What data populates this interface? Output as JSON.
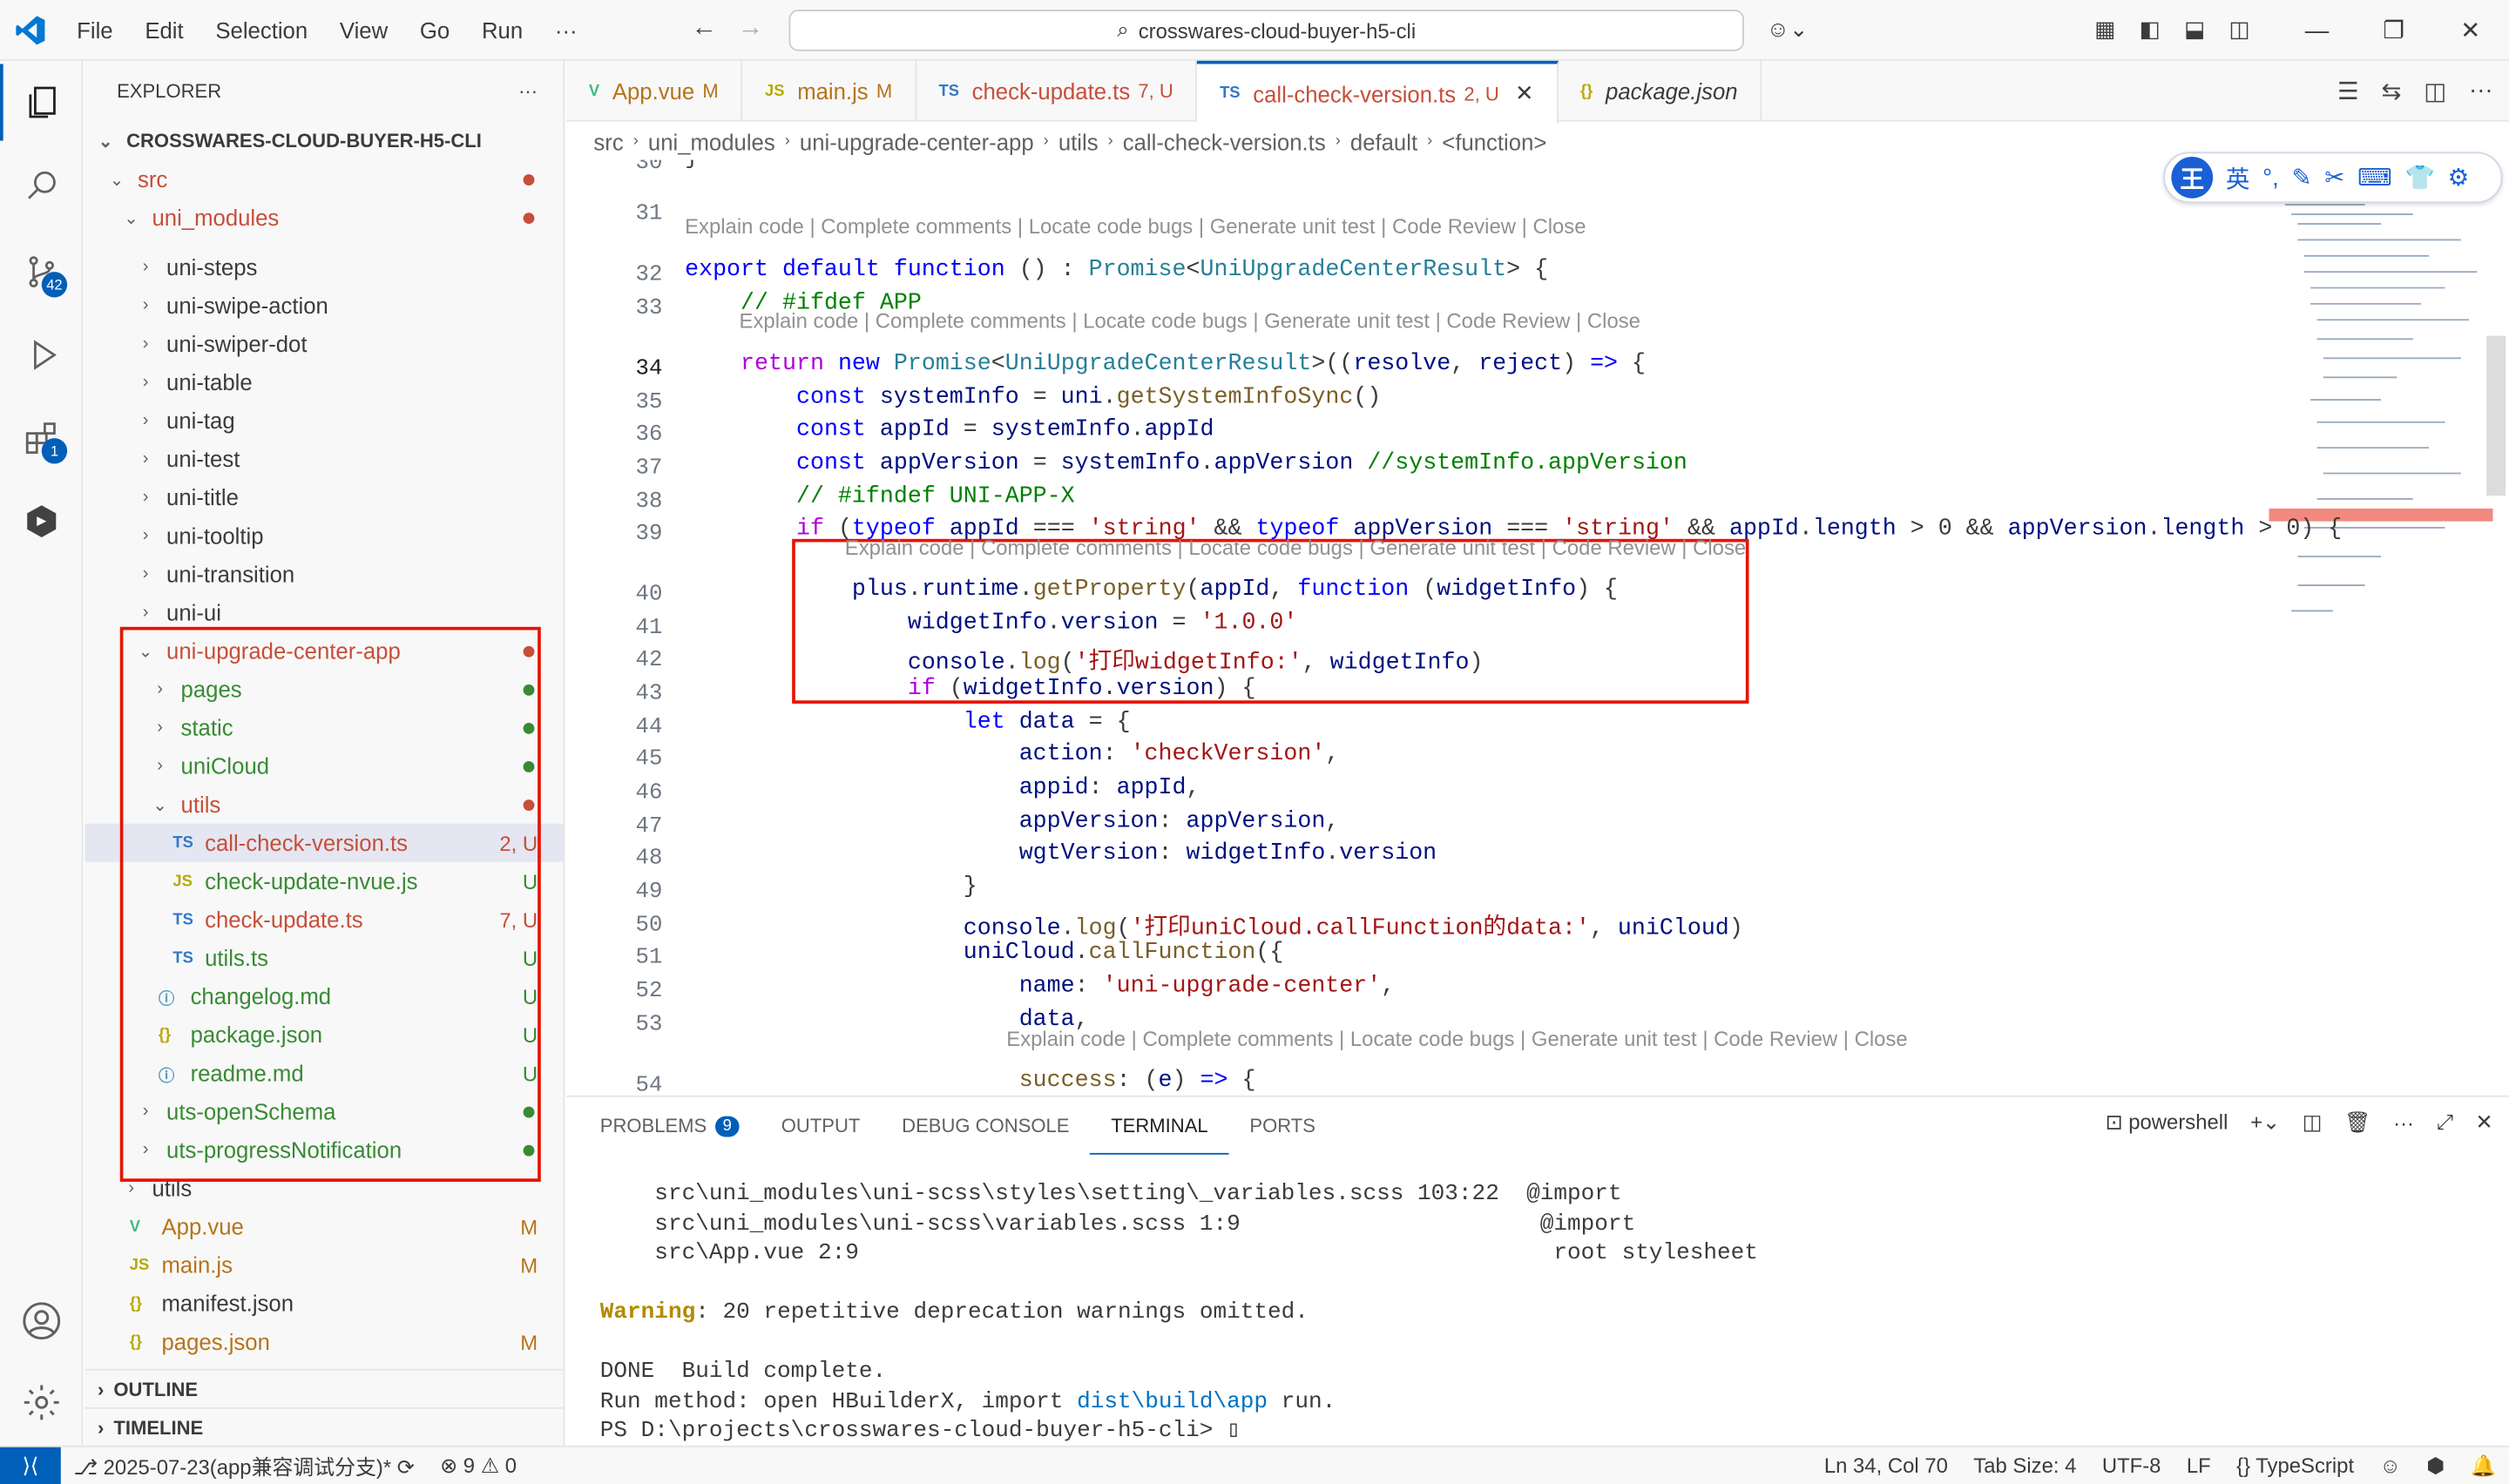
{
  "menu": [
    "File",
    "Edit",
    "Selection",
    "View",
    "Go",
    "Run",
    "···"
  ],
  "search": "crosswares-cloud-buyer-h5-cli",
  "explorer": {
    "title": "EXPLORER",
    "project": "CROSSWARES-CLOUD-BUYER-H5-CLI"
  },
  "tree": [
    {
      "label": "src",
      "indent": 1,
      "chev": "⌄",
      "cls": "red",
      "dot": "#c74e39"
    },
    {
      "label": "uni_modules",
      "indent": 2,
      "chev": "⌄",
      "cls": "red",
      "dot": "#c74e39"
    },
    {
      "label": "uni-steps",
      "indent": 3,
      "chev": "›",
      "cls": ""
    },
    {
      "label": "uni-swipe-action",
      "indent": 3,
      "chev": "›",
      "cls": ""
    },
    {
      "label": "uni-swiper-dot",
      "indent": 3,
      "chev": "›",
      "cls": ""
    },
    {
      "label": "uni-table",
      "indent": 3,
      "chev": "›",
      "cls": ""
    },
    {
      "label": "uni-tag",
      "indent": 3,
      "chev": "›",
      "cls": ""
    },
    {
      "label": "uni-test",
      "indent": 3,
      "chev": "›",
      "cls": ""
    },
    {
      "label": "uni-title",
      "indent": 3,
      "chev": "›",
      "cls": ""
    },
    {
      "label": "uni-tooltip",
      "indent": 3,
      "chev": "›",
      "cls": ""
    },
    {
      "label": "uni-transition",
      "indent": 3,
      "chev": "›",
      "cls": ""
    },
    {
      "label": "uni-ui",
      "indent": 3,
      "chev": "›",
      "cls": ""
    },
    {
      "label": "uni-upgrade-center-app",
      "indent": 3,
      "chev": "⌄",
      "cls": "red",
      "dot": "#c74e39"
    },
    {
      "label": "pages",
      "indent": 4,
      "chev": "›",
      "cls": "green",
      "dot": "#388a34"
    },
    {
      "label": "static",
      "indent": 4,
      "chev": "›",
      "cls": "green",
      "dot": "#388a34"
    },
    {
      "label": "uniCloud",
      "indent": 4,
      "chev": "›",
      "cls": "green",
      "dot": "#388a34"
    },
    {
      "label": "utils",
      "indent": 4,
      "chev": "⌄",
      "cls": "red",
      "dot": "#c74e39"
    },
    {
      "label": "call-check-version.ts",
      "indent": 5,
      "icon": "TS",
      "iconColor": "#3178c6",
      "cls": "red",
      "status": "2, U",
      "sel": true
    },
    {
      "label": "check-update-nvue.js",
      "indent": 5,
      "icon": "JS",
      "iconColor": "#b8a800",
      "cls": "green",
      "status": "U"
    },
    {
      "label": "check-update.ts",
      "indent": 5,
      "icon": "TS",
      "iconColor": "#3178c6",
      "cls": "red",
      "status": "7, U"
    },
    {
      "label": "utils.ts",
      "indent": 5,
      "icon": "TS",
      "iconColor": "#3178c6",
      "cls": "green",
      "status": "U"
    },
    {
      "label": "changelog.md",
      "indent": 4,
      "icon": "ⓘ",
      "iconColor": "#519aba",
      "cls": "green",
      "status": "U"
    },
    {
      "label": "package.json",
      "indent": 4,
      "icon": "{}",
      "iconColor": "#b8a800",
      "cls": "green",
      "status": "U"
    },
    {
      "label": "readme.md",
      "indent": 4,
      "icon": "ⓘ",
      "iconColor": "#519aba",
      "cls": "green",
      "status": "U"
    },
    {
      "label": "uts-openSchema",
      "indent": 3,
      "chev": "›",
      "cls": "green",
      "dot": "#388a34"
    },
    {
      "label": "uts-progressNotification",
      "indent": 3,
      "chev": "›",
      "cls": "green",
      "dot": "#388a34"
    },
    {
      "label": "utils",
      "indent": 2,
      "chev": "›",
      "cls": ""
    },
    {
      "label": "App.vue",
      "indent": 2,
      "icon": "V",
      "iconColor": "#41b883",
      "cls": "mod",
      "status": "M"
    },
    {
      "label": "main.js",
      "indent": 2,
      "icon": "JS",
      "iconColor": "#b8a800",
      "cls": "mod",
      "status": "M"
    },
    {
      "label": "manifest.json",
      "indent": 2,
      "icon": "{}",
      "iconColor": "#b8a800",
      "cls": ""
    },
    {
      "label": "pages.json",
      "indent": 2,
      "icon": "{}",
      "iconColor": "#b8a800",
      "cls": "mod",
      "status": "M"
    }
  ],
  "outline": "OUTLINE",
  "timeline": "TIMELINE",
  "tabs": [
    {
      "icon": "V",
      "iconColor": "#41b883",
      "label": "App.vue",
      "status": "M",
      "cls": "mod"
    },
    {
      "icon": "JS",
      "iconColor": "#b8a800",
      "label": "main.js",
      "status": "M",
      "cls": "mod"
    },
    {
      "icon": "TS",
      "iconColor": "#3178c6",
      "label": "check-update.ts",
      "status": "7, U",
      "cls": "red"
    },
    {
      "icon": "TS",
      "iconColor": "#3178c6",
      "label": "call-check-version.ts",
      "status": "2, U",
      "cls": "red",
      "active": true
    },
    {
      "icon": "{}",
      "iconColor": "#b8a800",
      "label": "package.json",
      "status": "",
      "cls": "",
      "italic": true
    }
  ],
  "breadcrumb": [
    "src",
    "uni_modules",
    "uni-upgrade-center-app",
    "utils",
    "call-check-version.ts",
    "default",
    "<function>"
  ],
  "lens": "Explain code | Complete comments | Locate code bugs | Generate unit test | Code Review | Close",
  "code": {
    "l30": "}",
    "l31": "",
    "l32": "<span class='kw'>export default function</span> () : <span class='ty'>Promise</span>&lt;<span class='ty'>UniUpgradeCenterResult</span>&gt; {",
    "l33": "    <span class='cm'>// #ifdef APP</span>",
    "l34": "    <span class='ctl'>return</span> <span class='kw'>new</span> <span class='ty'>Promise</span>&lt;<span class='ty'>UniUpgradeCenterResult</span>&gt;((<span class='va'>resolve</span>, <span class='va'>reject</span>) <span class='kw'>=&gt;</span> {",
    "l35": "        <span class='kw'>const</span> <span class='va'>systemInfo</span> = <span class='va'>uni</span>.<span class='fn'>getSystemInfoSync</span>()",
    "l36": "        <span class='kw'>const</span> <span class='va'>appId</span> = <span class='va'>systemInfo</span>.<span class='va'>appId</span>",
    "l37": "        <span class='kw'>const</span> <span class='va'>appVersion</span> = <span class='va'>systemInfo</span>.<span class='va'>appVersion</span> <span class='cm'>//systemInfo.appVersion</span>",
    "l38": "        <span class='cm'>// #ifndef UNI-APP-X</span>",
    "l39": "        <span class='ctl'>if</span> (<span class='kw'>typeof</span> <span class='va'>appId</span> === <span class='str'>'string'</span> &amp;&amp; <span class='kw'>typeof</span> <span class='va'>appVersion</span> === <span class='str'>'string'</span> &amp;&amp; <span class='va'>appId</span>.<span class='va'>length</span> &gt; 0 &amp;&amp; <span class='va'>appVersion</span>.<span class='va'>length</span> &gt; 0) {",
    "l40": "            <span class='va'>plus</span>.<span class='va'>runtime</span>.<span class='fn'>getProperty</span>(<span class='va'>appId</span>, <span class='kw'>function</span> (<span class='va'>widgetInfo</span>) {",
    "l41": "                <span class='va'>widgetInfo</span>.<span class='va'>version</span> = <span class='str'>'1.0.0'</span>",
    "l42": "                <span class='va'>console</span>.<span class='fn'>log</span>(<span class='str'>'打印widgetInfo:'</span>, <span class='va'>widgetInfo</span>)",
    "l43": "                <span class='ctl'>if</span> (<span class='va'>widgetInfo</span>.<span class='va'>version</span>) {",
    "l44": "                    <span class='kw'>let</span> <span class='va'>data</span> = {",
    "l45": "                        <span class='va'>action</span>: <span class='str'>'checkVersion'</span>,",
    "l46": "                        <span class='va'>appid</span>: <span class='va'>appId</span>,",
    "l47": "                        <span class='va'>appVersion</span>: <span class='va'>appVersion</span>,",
    "l48": "                        <span class='va'>wgtVersion</span>: <span class='va'>widgetInfo</span>.<span class='va'>version</span>",
    "l49": "                    }",
    "l50": "                    <span class='va'>console</span>.<span class='fn'>log</span>(<span class='str'>'打印uniCloud.callFunction的data:'</span>, <span class='va'>uniCloud</span>)",
    "l51": "                    <span class='va'>uniCloud</span>.<span class='fn'>callFunction</span>({",
    "l52": "                        <span class='va'>name</span>: <span class='str'>'uni-upgrade-center'</span>,",
    "l53": "                        <span class='va'>data</span>,",
    "l54": "                        <span class='fn'>success</span>: (<span class='va'>e</span>) <span class='kw'>=&gt;</span> {"
  },
  "panel": {
    "tabs": [
      "PROBLEMS",
      "OUTPUT",
      "DEBUG CONSOLE",
      "TERMINAL",
      "PORTS"
    ],
    "problems_count": "9",
    "shell": "powershell"
  },
  "terminal": [
    "    src\\uni_modules\\uni-scss\\styles\\setting\\_variables.scss 103:22  @import",
    "    src\\uni_modules\\uni-scss\\variables.scss 1:9                      @import",
    "    src\\App.vue 2:9                                                   root stylesheet",
    "",
    "<b style='color:#b58900'>Warning</b>: 20 repetitive deprecation warnings omitted.",
    "",
    "DONE  Build complete.",
    "Run method: open HBuilderX, import <span style='color:#0070c1'>dist\\build\\app</span> run.",
    "PS D:\\projects\\crosswares-cloud-buyer-h5-cli> ▯"
  ],
  "status": {
    "branch": "2025-07-23(app兼容调试分支)*",
    "errors": "9",
    "warnings": "0",
    "position": "Ln 34, Col 70",
    "tabsize": "Tab Size: 4",
    "encoding": "UTF-8",
    "eol": "LF",
    "language": "TypeScript"
  },
  "ime": {
    "w": "王",
    "lang": "英"
  }
}
